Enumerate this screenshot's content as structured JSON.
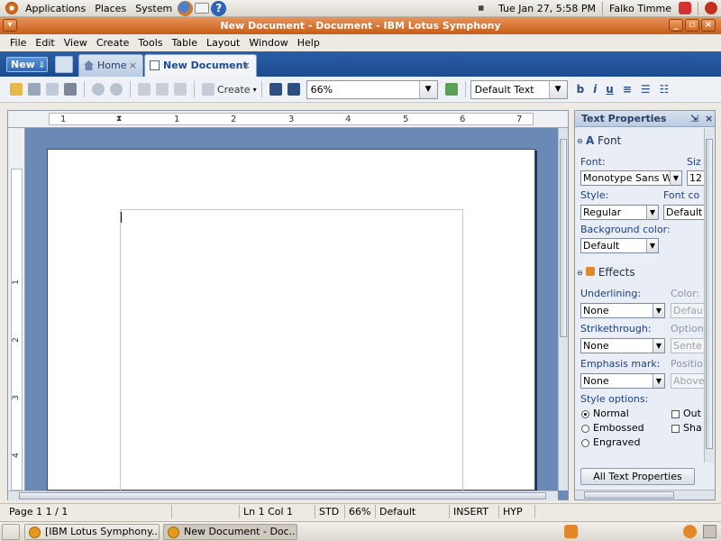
{
  "top_panel": {
    "menus": [
      "Applications",
      "Places",
      "System"
    ],
    "datetime": "Tue Jan 27,  5:58 PM",
    "user": "Falko Timme"
  },
  "window": {
    "title": "New Document - Document - IBM Lotus Symphony"
  },
  "menubar": [
    "File",
    "Edit",
    "View",
    "Create",
    "Tools",
    "Table",
    "Layout",
    "Window",
    "Help"
  ],
  "tabs": {
    "new_label": "New",
    "home_label": "Home",
    "doc_label": "New Document"
  },
  "toolbar": {
    "create_label": "Create",
    "zoom_value": "66%",
    "style_value": "Default Text"
  },
  "ruler": {
    "h_numbers": [
      "1",
      "1",
      "2",
      "3",
      "4",
      "5",
      "6",
      "7"
    ],
    "v_numbers": [
      "1",
      "2",
      "3",
      "4"
    ]
  },
  "side_panel": {
    "title": "Text Properties",
    "font_section": "Font",
    "font_label": "Font:",
    "font_value": "Monotype Sans W",
    "size_label": "Siz",
    "size_value": "12",
    "style_label": "Style:",
    "style_value": "Regular",
    "font_color_label": "Font co",
    "font_color_value": "Default",
    "bg_color_label": "Background color:",
    "bg_color_value": "Default",
    "effects_section": "Effects",
    "underlining_label": "Underlining:",
    "underlining_value": "None",
    "color_label": "Color:",
    "color_value": "Defau",
    "strike_label": "Strikethrough:",
    "strike_value": "None",
    "option_label": "Option",
    "option_value": "Sente",
    "emphasis_label": "Emphasis mark:",
    "emphasis_value": "None",
    "position_label": "Positio",
    "position_value": "Above",
    "style_options_label": "Style options:",
    "radio_normal": "Normal",
    "radio_embossed": "Embossed",
    "radio_engraved": "Engraved",
    "check_outline": "Out",
    "check_shadow": "Sha",
    "all_props_button": "All Text Properties"
  },
  "statusbar": {
    "page": "Page 1   1 / 1",
    "position": "Ln 1 Col 1",
    "mode": "STD",
    "zoom": "66%",
    "style": "Default",
    "insert": "INSERT",
    "hyp": "HYP"
  },
  "taskbar": {
    "task1": "[IBM Lotus Symphony...",
    "task2": "New Document - Doc..."
  }
}
